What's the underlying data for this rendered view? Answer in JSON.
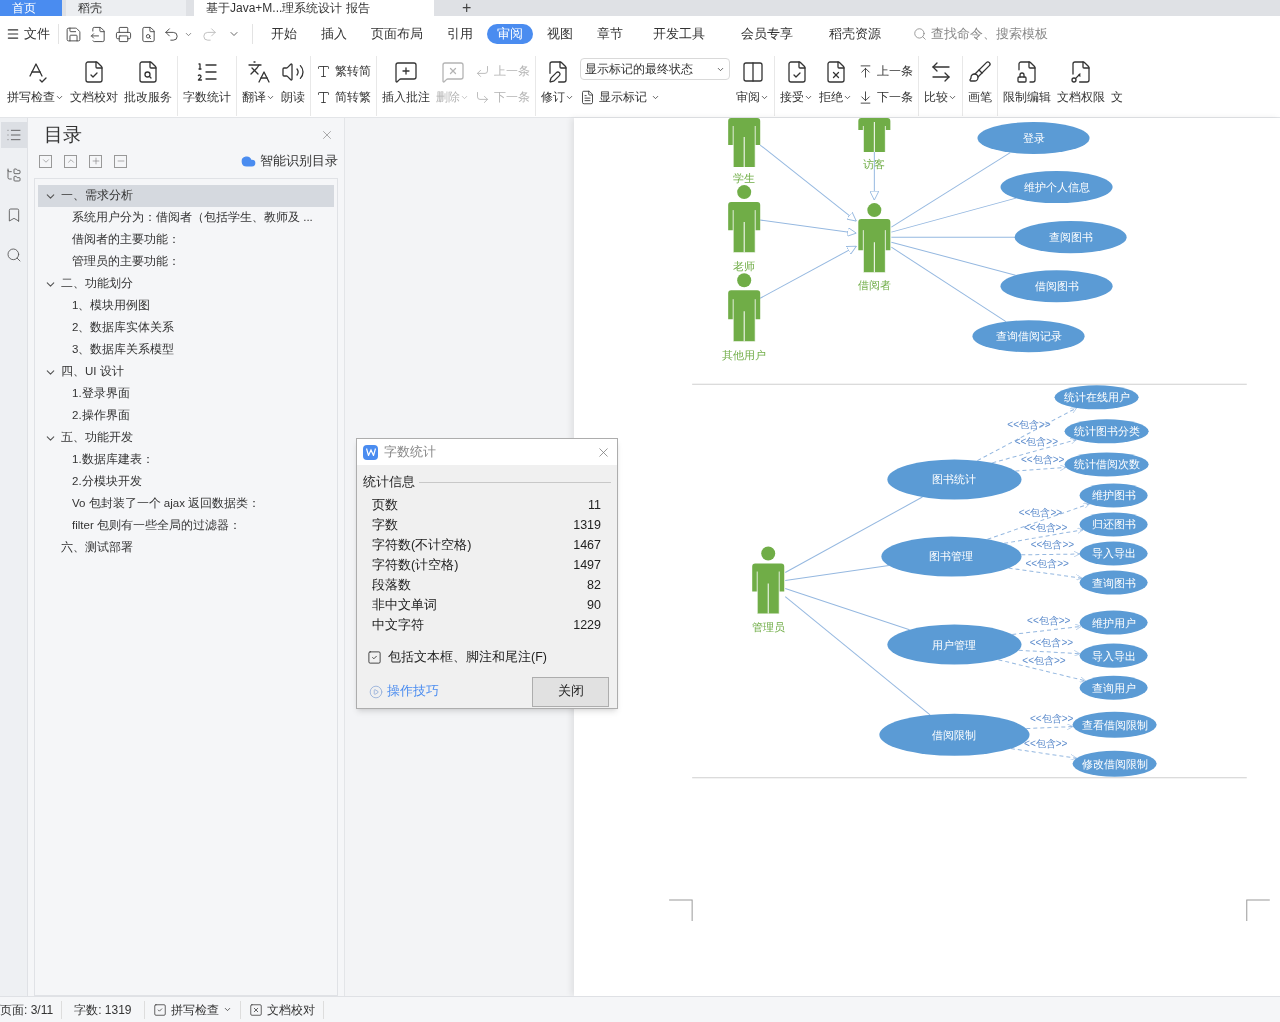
{
  "tab_bar": {
    "tabs": [
      {
        "label": "首页",
        "selected": false
      },
      {
        "label": "稻壳",
        "selected": false
      },
      {
        "label": "基于Java+M...理系统设计 报告",
        "selected": true
      }
    ],
    "new_tab": "+"
  },
  "menu_bar": {
    "file": "文件",
    "tabs": [
      {
        "label": "开始",
        "selected": false
      },
      {
        "label": "插入",
        "selected": false
      },
      {
        "label": "页面布局",
        "selected": false
      },
      {
        "label": "引用",
        "selected": false
      },
      {
        "label": "审阅",
        "selected": true
      },
      {
        "label": "视图",
        "selected": false
      },
      {
        "label": "章节",
        "selected": false
      },
      {
        "label": "开发工具",
        "selected": false
      },
      {
        "label": "会员专享",
        "selected": false
      },
      {
        "label": "稻壳资源",
        "selected": false
      }
    ],
    "search": {
      "placeholder": "查找命令、搜索模板"
    }
  },
  "ribbon": {
    "groups": [
      [
        {
          "kind": "large",
          "label": "拼写检查",
          "menu": true,
          "disabled": false
        },
        {
          "kind": "large",
          "label": "文档校对",
          "menu": false,
          "disabled": false
        },
        {
          "kind": "large",
          "label": "批改服务",
          "menu": false,
          "disabled": false
        }
      ],
      [
        {
          "kind": "large",
          "label": "字数统计",
          "menu": false,
          "disabled": false
        }
      ],
      [
        {
          "kind": "large",
          "label": "翻译",
          "menu": true,
          "disabled": false
        },
        {
          "kind": "large",
          "label": "朗读",
          "menu": false,
          "disabled": false
        }
      ],
      [
        {
          "kind": "stack",
          "items": [
            {
              "label": "繁转简",
              "disabled": false
            },
            {
              "label": "简转繁",
              "disabled": false
            }
          ]
        }
      ],
      [
        {
          "kind": "large",
          "label": "插入批注",
          "menu": false,
          "disabled": false
        },
        {
          "kind": "large",
          "label": "删除",
          "menu": true,
          "disabled": true
        },
        {
          "kind": "stack",
          "items": [
            {
              "label": "上一条",
              "disabled": true
            },
            {
              "label": "下一条",
              "disabled": true
            }
          ]
        }
      ],
      [
        {
          "kind": "large",
          "label": "修订",
          "menu": true,
          "disabled": false
        },
        {
          "kind": "select",
          "value": "显示标记的最终状态",
          "below": {
            "label": "显示标记",
            "menu": true
          }
        },
        {
          "kind": "large",
          "label": "审阅",
          "menu": true,
          "disabled": false
        }
      ],
      [
        {
          "kind": "large",
          "label": "接受",
          "menu": true,
          "disabled": false
        },
        {
          "kind": "large",
          "label": "拒绝",
          "menu": true,
          "disabled": false
        },
        {
          "kind": "stack",
          "items": [
            {
              "label": "上一条",
              "disabled": false
            },
            {
              "label": "下一条",
              "disabled": false
            }
          ]
        }
      ],
      [
        {
          "kind": "large",
          "label": "比较",
          "menu": true,
          "disabled": false
        }
      ],
      [
        {
          "kind": "large",
          "label": "画笔",
          "menu": false,
          "disabled": false
        }
      ],
      [
        {
          "kind": "large",
          "label": "限制编辑",
          "menu": false,
          "disabled": false
        },
        {
          "kind": "large",
          "label": "文档权限",
          "menu": false,
          "disabled": false
        },
        {
          "kind": "large",
          "label": "文",
          "menu": false,
          "disabled": false
        }
      ]
    ]
  },
  "side_tools": [
    {
      "selected": true
    },
    {
      "selected": false
    },
    {
      "selected": false
    },
    {
      "selected": false
    }
  ],
  "toc": {
    "title": "目录",
    "smart_button": "智能识别目录",
    "items": [
      {
        "label": "一、需求分析",
        "selected": true,
        "expanded": true,
        "children": [
          {
            "label": "系统用户分为：借阅者（包括学生、教师及 ...",
            "selected": false
          },
          {
            "label": "借阅者的主要功能：",
            "selected": false
          },
          {
            "label": "管理员的主要功能：",
            "selected": false
          }
        ]
      },
      {
        "label": "二、功能划分",
        "selected": false,
        "expanded": true,
        "children": [
          {
            "label": "1、模块用例图",
            "selected": false
          },
          {
            "label": "2、数据库实体关系",
            "selected": false
          },
          {
            "label": "3、数据库关系模型",
            "selected": false
          }
        ]
      },
      {
        "label": "四、UI 设计",
        "selected": false,
        "expanded": true,
        "children": [
          {
            "label": "1.登录界面",
            "selected": false
          },
          {
            "label": "2.操作界面",
            "selected": false
          }
        ]
      },
      {
        "label": "五、功能开发",
        "selected": false,
        "expanded": true,
        "children": [
          {
            "label": "1.数据库建表：",
            "selected": false
          },
          {
            "label": "2.分模块开发",
            "selected": false
          },
          {
            "label": "Vo 包封装了一个 ajax 返回数据类：",
            "selected": false
          },
          {
            "label": "filter 包则有一些全局的过滤器：",
            "selected": false
          }
        ]
      },
      {
        "label": "六、测试部署",
        "selected": false
      }
    ]
  },
  "document": {
    "reader_diagram": {
      "actors": [
        {
          "label": "学生"
        },
        {
          "label": "访客"
        },
        {
          "label": "老师"
        },
        {
          "label": "其他用户"
        },
        {
          "label": "借阅者"
        }
      ],
      "use_cases": [
        {
          "label": "登录"
        },
        {
          "label": "维护个人信息"
        },
        {
          "label": "查阅图书"
        },
        {
          "label": "借阅图书"
        },
        {
          "label": "查询借阅记录"
        }
      ]
    },
    "admin_diagram": {
      "actor": {
        "label": "管理员"
      },
      "use_cases": [
        {
          "label": "图书统计",
          "includes": [
            {
              "label": "统计在线用户",
              "relation": "<<包含>>"
            },
            {
              "label": "统计图书分类",
              "relation": "<<包含>>"
            },
            {
              "label": "统计借阅次数",
              "relation": "<<包含>>"
            }
          ]
        },
        {
          "label": "图书管理",
          "includes": [
            {
              "label": "维护图书",
              "relation": "<<包含>>"
            },
            {
              "label": "归还图书",
              "relation": "<<包含>>"
            },
            {
              "label": "导入导出",
              "relation": "<<包含>>"
            },
            {
              "label": "查询图书",
              "relation": "<<包含>>"
            }
          ]
        },
        {
          "label": "用户管理",
          "includes": [
            {
              "label": "维护用户",
              "relation": "<<包含>>"
            },
            {
              "label": "导入导出",
              "relation": "<<包含>>"
            },
            {
              "label": "查询用户",
              "relation": "<<包含>>"
            }
          ]
        },
        {
          "label": "借阅限制",
          "includes": [
            {
              "label": "查看借阅限制",
              "relation": "<<包含>>"
            },
            {
              "label": "修改借阅限制",
              "relation": "<<包含>>"
            }
          ]
        }
      ]
    }
  },
  "word_count_dialog": {
    "title": "字数统计",
    "section": "统计信息",
    "stats": [
      {
        "label": "页数",
        "value": "11"
      },
      {
        "label": "字数",
        "value": "1319"
      },
      {
        "label": "字符数(不计空格)",
        "value": "1467"
      },
      {
        "label": "字符数(计空格)",
        "value": "1497"
      },
      {
        "label": "段落数",
        "value": "82"
      },
      {
        "label": "非中文单词",
        "value": "90"
      },
      {
        "label": "中文字符",
        "value": "1229"
      }
    ],
    "option": {
      "label": "包括文本框、脚注和尾注(F)",
      "checked": true
    },
    "tips_link": "操作技巧",
    "close_button": "关闭"
  },
  "status_bar": {
    "page": "页面: 3/11",
    "words": "字数: 1319",
    "spell_check": "拼写检查",
    "proofread": "文档校对"
  }
}
